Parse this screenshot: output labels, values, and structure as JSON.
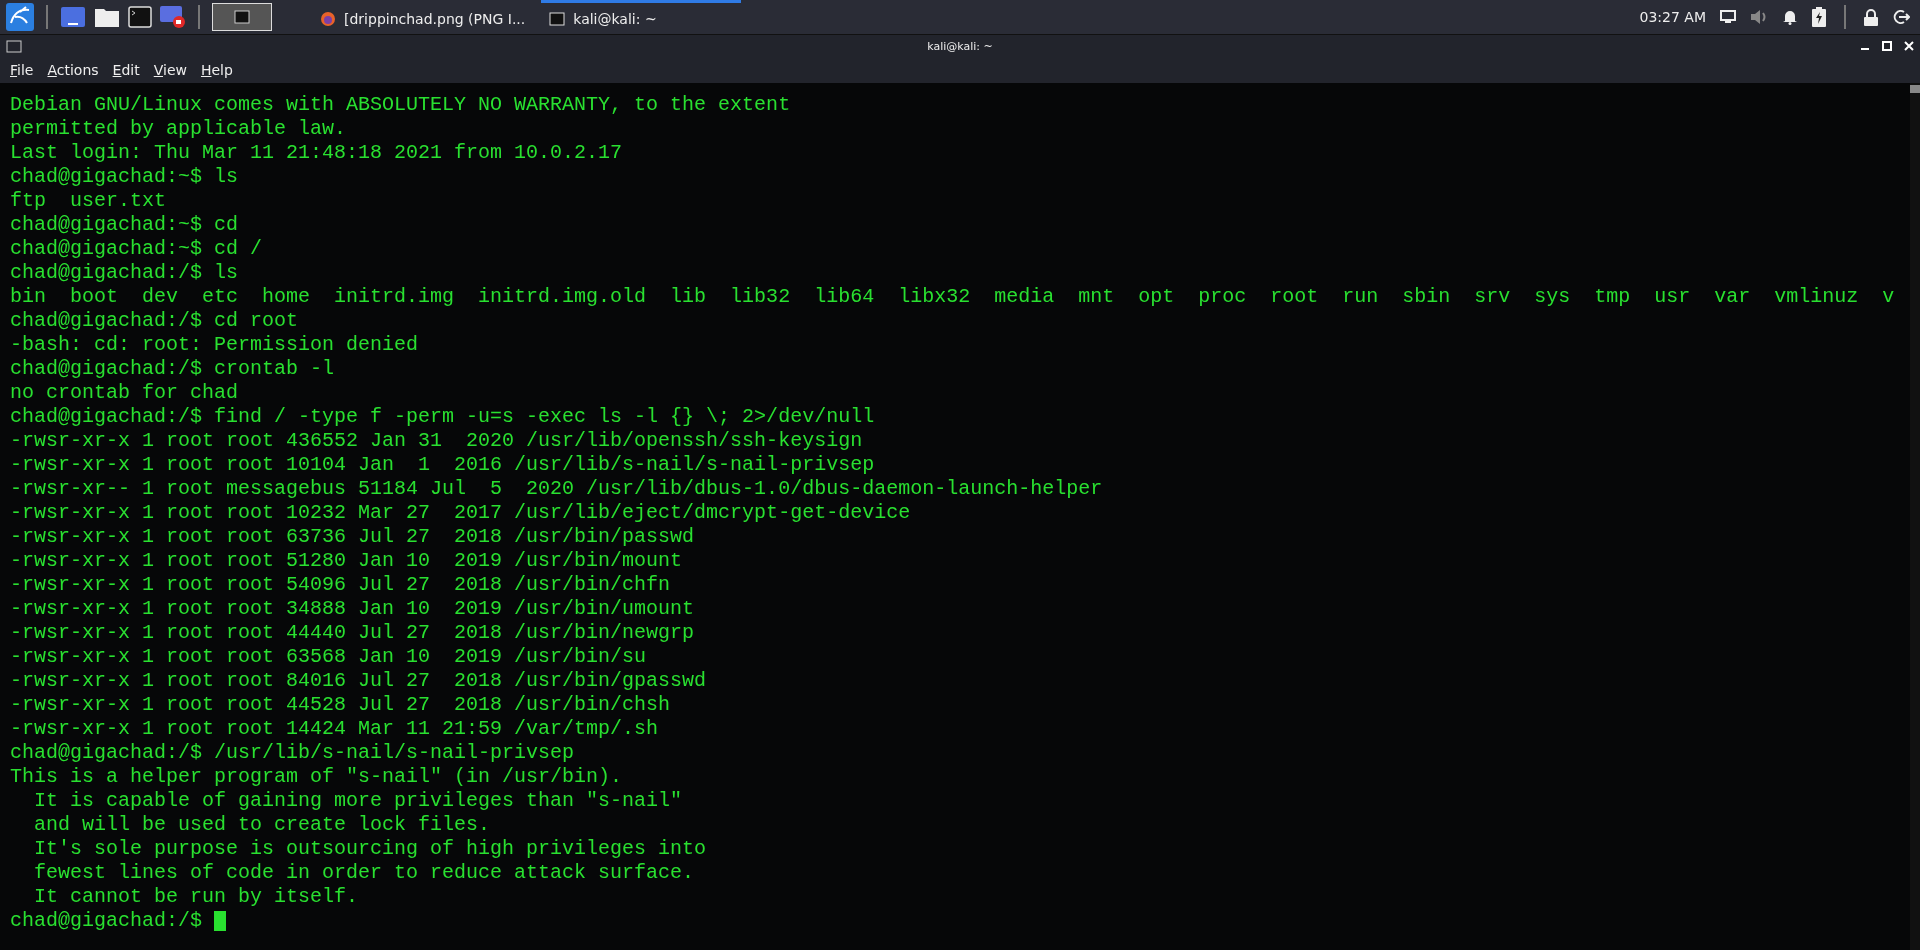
{
  "taskbar": {
    "tasks": [
      {
        "label": "[drippinchad.png (PNG I...",
        "kind": "browser",
        "selected": false
      },
      {
        "label": "kali@kali: ~",
        "kind": "terminal",
        "selected": true
      }
    ],
    "clock": "03:27 AM"
  },
  "window": {
    "title": "kali@kali: ~"
  },
  "menu": [
    "File",
    "Actions",
    "Edit",
    "View",
    "Help"
  ],
  "terminal": {
    "lines": [
      "Debian GNU/Linux comes with ABSOLUTELY NO WARRANTY, to the extent",
      "permitted by applicable law.",
      "Last login: Thu Mar 11 21:48:18 2021 from 10.0.2.17",
      "chad@gigachad:~$ ls",
      "ftp  user.txt",
      "chad@gigachad:~$ cd",
      "chad@gigachad:~$ cd /",
      "chad@gigachad:/$ ls",
      "bin  boot  dev  etc  home  initrd.img  initrd.img.old  lib  lib32  lib64  libx32  media  mnt  opt  proc  root  run  sbin  srv  sys  tmp  usr  var  vmlinuz  v",
      "chad@gigachad:/$ cd root",
      "-bash: cd: root: Permission denied",
      "chad@gigachad:/$ crontab -l",
      "no crontab for chad",
      "chad@gigachad:/$ find / -type f -perm -u=s -exec ls -l {} \\; 2>/dev/null",
      "-rwsr-xr-x 1 root root 436552 Jan 31  2020 /usr/lib/openssh/ssh-keysign",
      "-rwsr-xr-x 1 root root 10104 Jan  1  2016 /usr/lib/s-nail/s-nail-privsep",
      "-rwsr-xr-- 1 root messagebus 51184 Jul  5  2020 /usr/lib/dbus-1.0/dbus-daemon-launch-helper",
      "-rwsr-xr-x 1 root root 10232 Mar 27  2017 /usr/lib/eject/dmcrypt-get-device",
      "-rwsr-xr-x 1 root root 63736 Jul 27  2018 /usr/bin/passwd",
      "-rwsr-xr-x 1 root root 51280 Jan 10  2019 /usr/bin/mount",
      "-rwsr-xr-x 1 root root 54096 Jul 27  2018 /usr/bin/chfn",
      "-rwsr-xr-x 1 root root 34888 Jan 10  2019 /usr/bin/umount",
      "-rwsr-xr-x 1 root root 44440 Jul 27  2018 /usr/bin/newgrp",
      "-rwsr-xr-x 1 root root 63568 Jan 10  2019 /usr/bin/su",
      "-rwsr-xr-x 1 root root 84016 Jul 27  2018 /usr/bin/gpasswd",
      "-rwsr-xr-x 1 root root 44528 Jul 27  2018 /usr/bin/chsh",
      "-rwsr-xr-x 1 root root 14424 Mar 11 21:59 /var/tmp/.sh",
      "chad@gigachad:/$ /usr/lib/s-nail/s-nail-privsep",
      "This is a helper program of \"s-nail\" (in /usr/bin).",
      "  It is capable of gaining more privileges than \"s-nail\"",
      "  and will be used to create lock files.",
      "  It's sole purpose is outsourcing of high privileges into",
      "  fewest lines of code in order to reduce attack surface.",
      "  It cannot be run by itself."
    ],
    "prompt": "chad@gigachad:/$ ",
    "cursor": true
  }
}
